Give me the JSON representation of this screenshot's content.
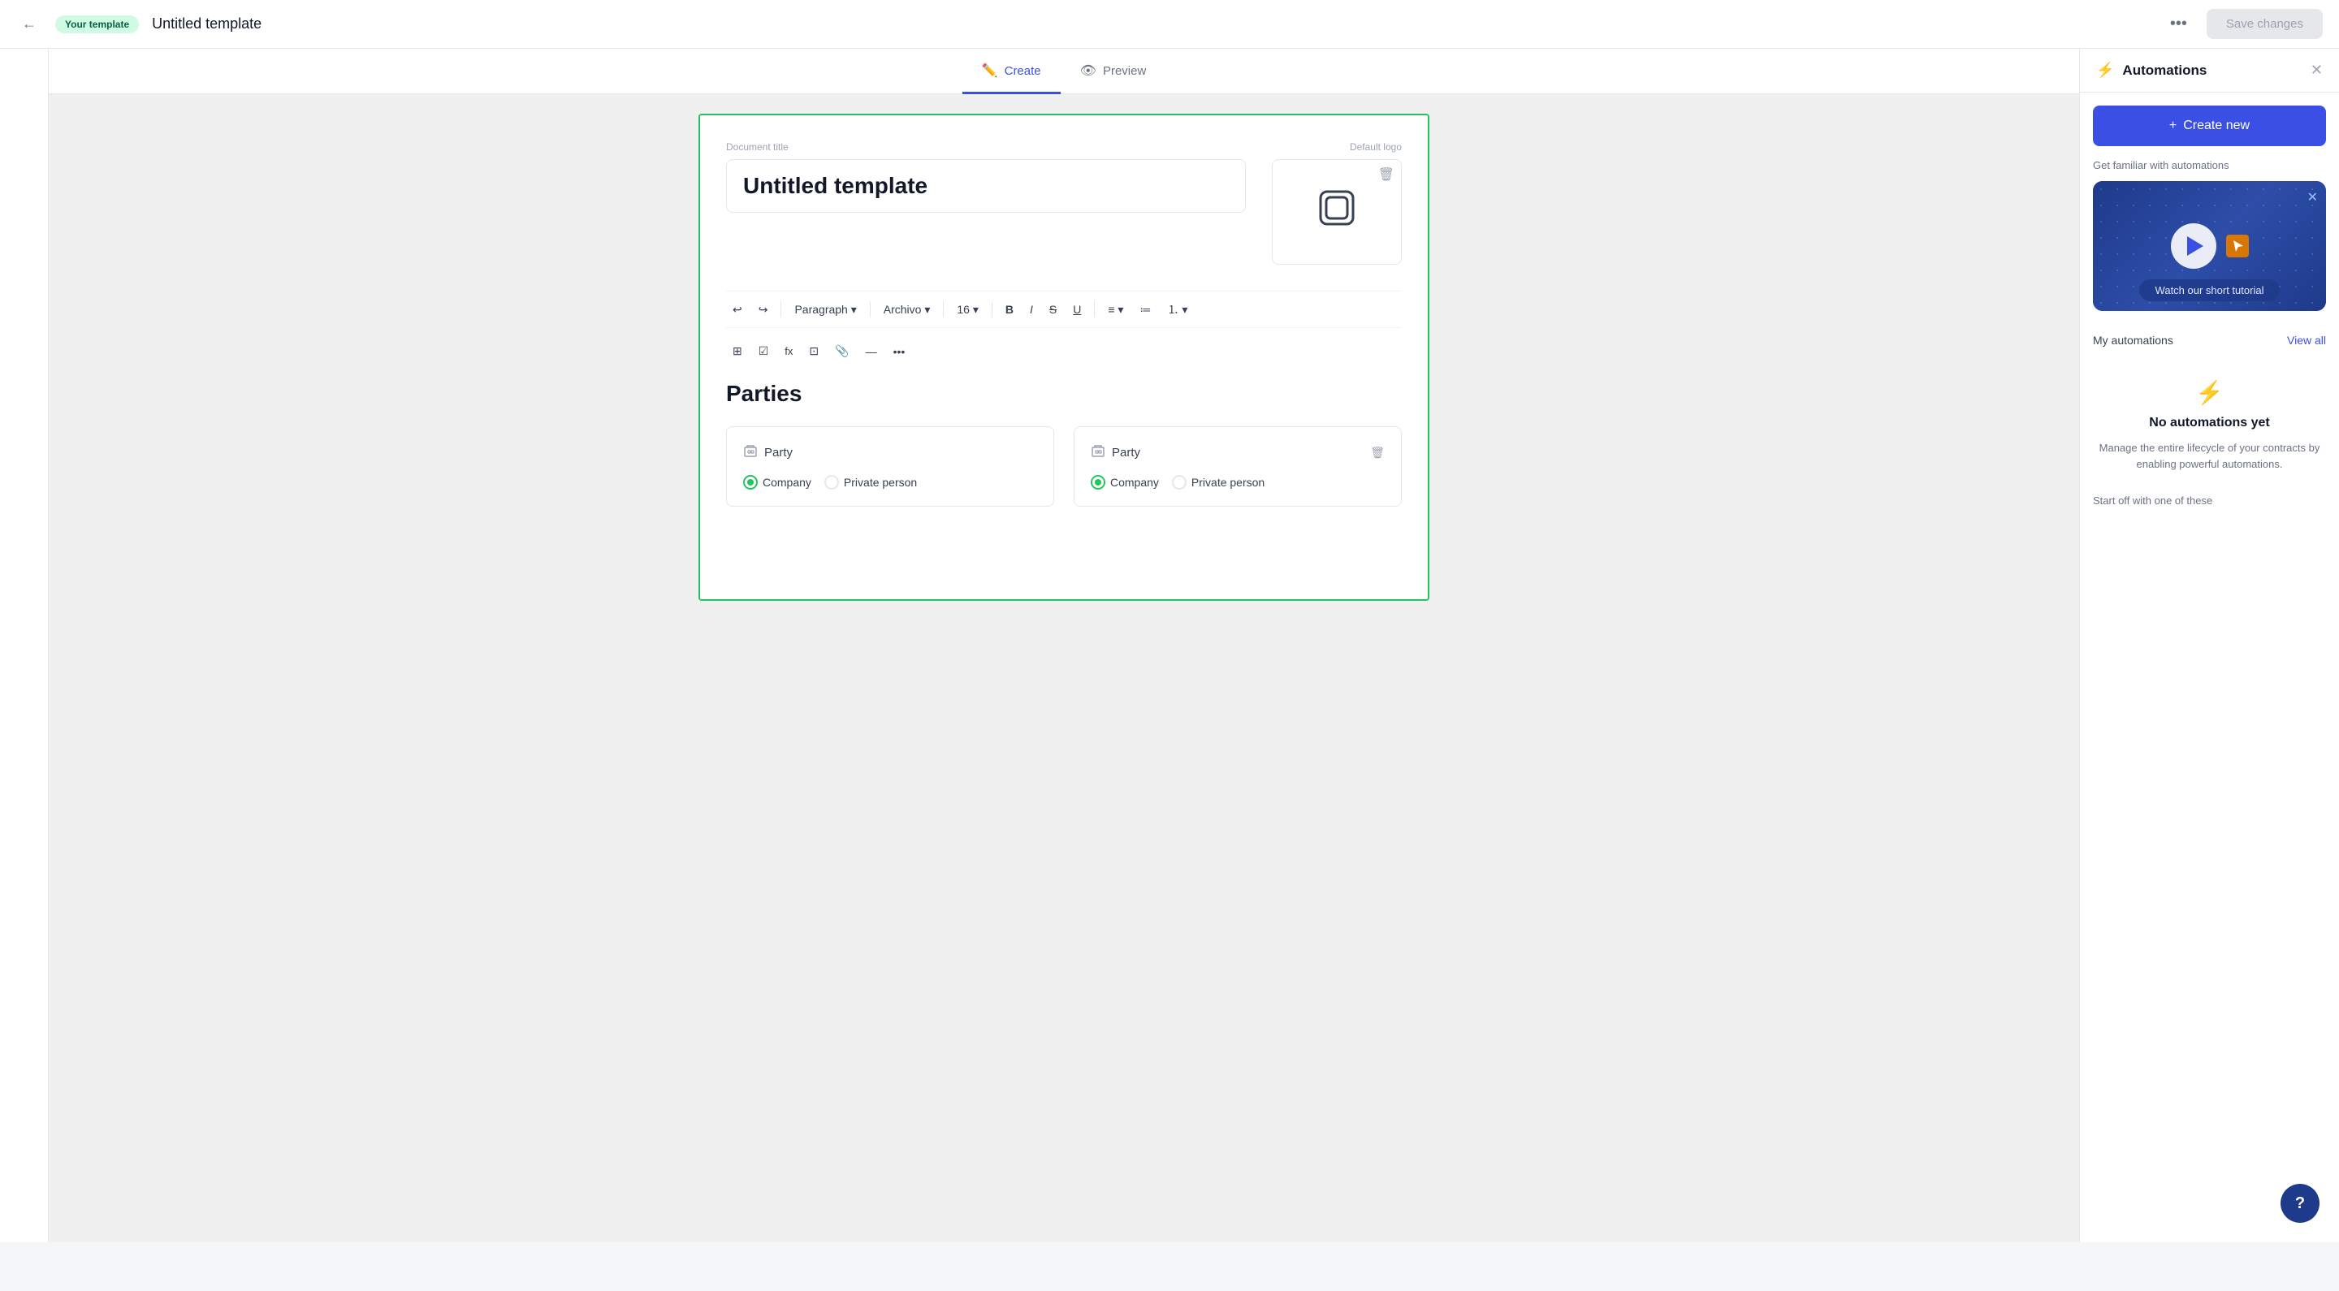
{
  "topbar": {
    "back_icon": "←",
    "badge_label": "Your template",
    "title": "Untitled template",
    "dots_icon": "•••",
    "save_label": "Save changes"
  },
  "tabs": [
    {
      "id": "create",
      "label": "Create",
      "icon": "✏️",
      "active": true
    },
    {
      "id": "preview",
      "label": "Preview",
      "icon": "👁",
      "active": false
    }
  ],
  "editor": {
    "doc_title_label": "Document title",
    "doc_title_value": "Untitled template",
    "logo_label": "Default logo",
    "toolbar_row1": [
      {
        "id": "undo",
        "label": "↩"
      },
      {
        "id": "redo",
        "label": "↪"
      },
      {
        "id": "sep1",
        "type": "sep"
      },
      {
        "id": "paragraph",
        "label": "Paragraph",
        "hasArrow": true
      },
      {
        "id": "sep2",
        "type": "sep"
      },
      {
        "id": "font",
        "label": "Archivo",
        "hasArrow": true
      },
      {
        "id": "sep3",
        "type": "sep"
      },
      {
        "id": "size",
        "label": "16",
        "hasArrow": true
      },
      {
        "id": "sep4",
        "type": "sep"
      },
      {
        "id": "bold",
        "label": "B"
      },
      {
        "id": "italic",
        "label": "I"
      },
      {
        "id": "strike",
        "label": "S"
      },
      {
        "id": "underline",
        "label": "U"
      },
      {
        "id": "sep5",
        "type": "sep"
      },
      {
        "id": "align",
        "label": "≡",
        "hasArrow": true
      },
      {
        "id": "bullets",
        "label": "≔"
      },
      {
        "id": "numbered",
        "label": "⒈",
        "hasArrow": true
      }
    ],
    "toolbar_row2": [
      {
        "id": "block",
        "label": "⊞"
      },
      {
        "id": "checkbox",
        "label": "☑"
      },
      {
        "id": "formula",
        "label": "fx"
      },
      {
        "id": "table",
        "label": "⊡"
      },
      {
        "id": "attach",
        "label": "📎"
      },
      {
        "id": "divider",
        "label": "—"
      },
      {
        "id": "more",
        "label": "•••"
      }
    ],
    "section_title": "Parties",
    "parties": [
      {
        "id": "party1",
        "title": "Party",
        "show_trash": false,
        "company_checked": true,
        "options": [
          "Company",
          "Private person"
        ]
      },
      {
        "id": "party2",
        "title": "Party",
        "show_trash": true,
        "company_checked": true,
        "options": [
          "Company",
          "Private person"
        ]
      }
    ]
  },
  "right_panel": {
    "lightning_icon": "⚡",
    "title": "Automations",
    "close_icon": "✕",
    "create_new_icon": "+",
    "create_new_label": "Create new",
    "familiar_label": "Get familiar with automations",
    "tutorial": {
      "watch_label": "Watch our short tutorial",
      "close_icon": "✕"
    },
    "my_automations_label": "My automations",
    "view_all_label": "View all",
    "no_auto_icon": "⚡",
    "no_auto_title": "No automations yet",
    "no_auto_desc": "Manage the entire lifecycle of your contracts by enabling powerful automations.",
    "start_off_label": "Start off with one of these"
  },
  "help": {
    "label": "?"
  }
}
